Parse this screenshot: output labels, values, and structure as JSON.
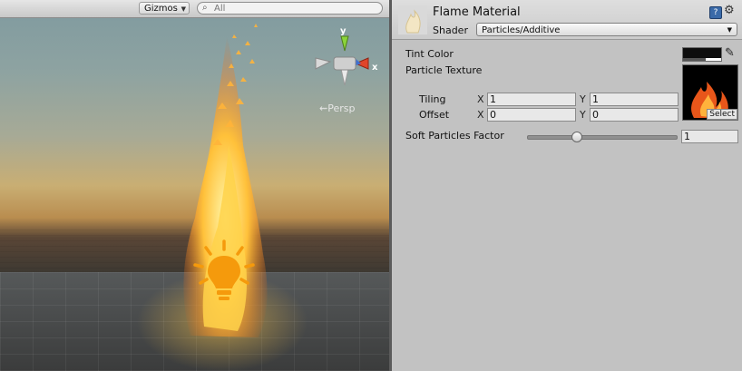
{
  "scene": {
    "gizmos_label": "Gizmos",
    "search_placeholder": "All",
    "persp_label": "⇜Persp",
    "axis_labels": {
      "y": "y",
      "x": "x"
    }
  },
  "inspector": {
    "material_name": "Flame Material",
    "shader_label": "Shader",
    "shader_value": "Particles/Additive",
    "tint_color_label": "Tint Color",
    "particle_texture_label": "Particle Texture",
    "tiling_label": "Tiling",
    "offset_label": "Offset",
    "tiling_x": "1",
    "tiling_y": "1",
    "offset_x": "0",
    "offset_y": "0",
    "x_label": "X",
    "y_label": "Y",
    "texture_select_label": "Select",
    "soft_particles_label": "Soft Particles Factor",
    "soft_particles_value": "1",
    "soft_particles_slider_fraction": 0.33,
    "help_icon_glyph": "?",
    "gear_icon_glyph": "⚙"
  },
  "colors": {
    "inspector_bg": "#c2c2c2",
    "flame": "#ff9a1f",
    "light_icon": "#f59a0c"
  }
}
